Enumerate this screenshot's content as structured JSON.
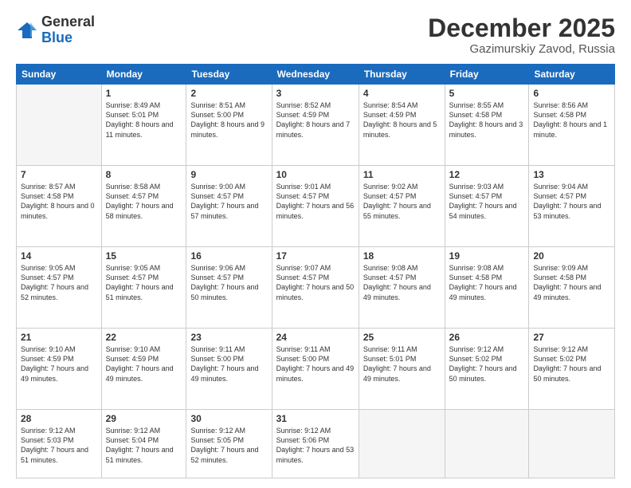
{
  "header": {
    "logo_general": "General",
    "logo_blue": "Blue",
    "month_title": "December 2025",
    "location": "Gazimurskiy Zavod, Russia"
  },
  "days_of_week": [
    "Sunday",
    "Monday",
    "Tuesday",
    "Wednesday",
    "Thursday",
    "Friday",
    "Saturday"
  ],
  "weeks": [
    [
      {
        "day": "",
        "info": ""
      },
      {
        "day": "1",
        "info": "Sunrise: 8:49 AM\nSunset: 5:01 PM\nDaylight: 8 hours\nand 11 minutes."
      },
      {
        "day": "2",
        "info": "Sunrise: 8:51 AM\nSunset: 5:00 PM\nDaylight: 8 hours\nand 9 minutes."
      },
      {
        "day": "3",
        "info": "Sunrise: 8:52 AM\nSunset: 4:59 PM\nDaylight: 8 hours\nand 7 minutes."
      },
      {
        "day": "4",
        "info": "Sunrise: 8:54 AM\nSunset: 4:59 PM\nDaylight: 8 hours\nand 5 minutes."
      },
      {
        "day": "5",
        "info": "Sunrise: 8:55 AM\nSunset: 4:58 PM\nDaylight: 8 hours\nand 3 minutes."
      },
      {
        "day": "6",
        "info": "Sunrise: 8:56 AM\nSunset: 4:58 PM\nDaylight: 8 hours\nand 1 minute."
      }
    ],
    [
      {
        "day": "7",
        "info": "Sunrise: 8:57 AM\nSunset: 4:58 PM\nDaylight: 8 hours\nand 0 minutes."
      },
      {
        "day": "8",
        "info": "Sunrise: 8:58 AM\nSunset: 4:57 PM\nDaylight: 7 hours\nand 58 minutes."
      },
      {
        "day": "9",
        "info": "Sunrise: 9:00 AM\nSunset: 4:57 PM\nDaylight: 7 hours\nand 57 minutes."
      },
      {
        "day": "10",
        "info": "Sunrise: 9:01 AM\nSunset: 4:57 PM\nDaylight: 7 hours\nand 56 minutes."
      },
      {
        "day": "11",
        "info": "Sunrise: 9:02 AM\nSunset: 4:57 PM\nDaylight: 7 hours\nand 55 minutes."
      },
      {
        "day": "12",
        "info": "Sunrise: 9:03 AM\nSunset: 4:57 PM\nDaylight: 7 hours\nand 54 minutes."
      },
      {
        "day": "13",
        "info": "Sunrise: 9:04 AM\nSunset: 4:57 PM\nDaylight: 7 hours\nand 53 minutes."
      }
    ],
    [
      {
        "day": "14",
        "info": "Sunrise: 9:05 AM\nSunset: 4:57 PM\nDaylight: 7 hours\nand 52 minutes."
      },
      {
        "day": "15",
        "info": "Sunrise: 9:05 AM\nSunset: 4:57 PM\nDaylight: 7 hours\nand 51 minutes."
      },
      {
        "day": "16",
        "info": "Sunrise: 9:06 AM\nSunset: 4:57 PM\nDaylight: 7 hours\nand 50 minutes."
      },
      {
        "day": "17",
        "info": "Sunrise: 9:07 AM\nSunset: 4:57 PM\nDaylight: 7 hours\nand 50 minutes."
      },
      {
        "day": "18",
        "info": "Sunrise: 9:08 AM\nSunset: 4:57 PM\nDaylight: 7 hours\nand 49 minutes."
      },
      {
        "day": "19",
        "info": "Sunrise: 9:08 AM\nSunset: 4:58 PM\nDaylight: 7 hours\nand 49 minutes."
      },
      {
        "day": "20",
        "info": "Sunrise: 9:09 AM\nSunset: 4:58 PM\nDaylight: 7 hours\nand 49 minutes."
      }
    ],
    [
      {
        "day": "21",
        "info": "Sunrise: 9:10 AM\nSunset: 4:59 PM\nDaylight: 7 hours\nand 49 minutes."
      },
      {
        "day": "22",
        "info": "Sunrise: 9:10 AM\nSunset: 4:59 PM\nDaylight: 7 hours\nand 49 minutes."
      },
      {
        "day": "23",
        "info": "Sunrise: 9:11 AM\nSunset: 5:00 PM\nDaylight: 7 hours\nand 49 minutes."
      },
      {
        "day": "24",
        "info": "Sunrise: 9:11 AM\nSunset: 5:00 PM\nDaylight: 7 hours\nand 49 minutes."
      },
      {
        "day": "25",
        "info": "Sunrise: 9:11 AM\nSunset: 5:01 PM\nDaylight: 7 hours\nand 49 minutes."
      },
      {
        "day": "26",
        "info": "Sunrise: 9:12 AM\nSunset: 5:02 PM\nDaylight: 7 hours\nand 50 minutes."
      },
      {
        "day": "27",
        "info": "Sunrise: 9:12 AM\nSunset: 5:02 PM\nDaylight: 7 hours\nand 50 minutes."
      }
    ],
    [
      {
        "day": "28",
        "info": "Sunrise: 9:12 AM\nSunset: 5:03 PM\nDaylight: 7 hours\nand 51 minutes."
      },
      {
        "day": "29",
        "info": "Sunrise: 9:12 AM\nSunset: 5:04 PM\nDaylight: 7 hours\nand 51 minutes."
      },
      {
        "day": "30",
        "info": "Sunrise: 9:12 AM\nSunset: 5:05 PM\nDaylight: 7 hours\nand 52 minutes."
      },
      {
        "day": "31",
        "info": "Sunrise: 9:12 AM\nSunset: 5:06 PM\nDaylight: 7 hours\nand 53 minutes."
      },
      {
        "day": "",
        "info": ""
      },
      {
        "day": "",
        "info": ""
      },
      {
        "day": "",
        "info": ""
      }
    ]
  ]
}
